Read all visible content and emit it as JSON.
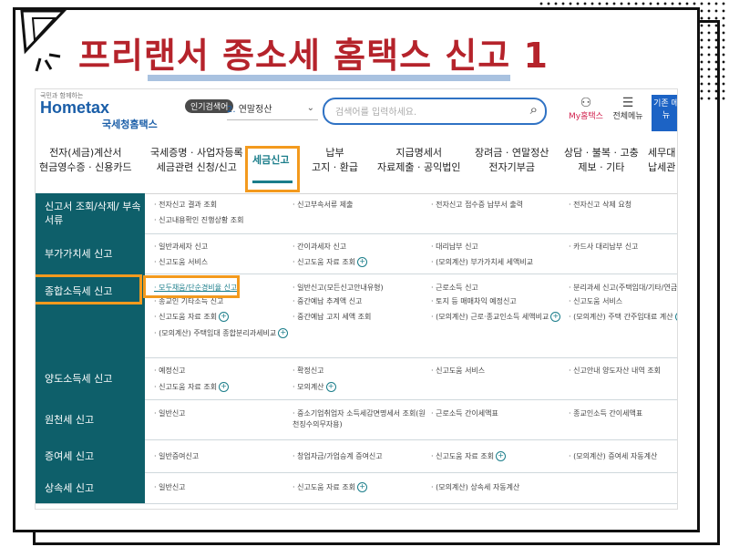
{
  "header": {
    "title": "프리랜서 종소세 홈택스 신고 1"
  },
  "topbar": {
    "logo_small": "국민과 함께하는",
    "logo_main": "Hometax",
    "logo_kr": "국세청홈택스",
    "popular_badge": "인기검색어",
    "popular_num": "2.",
    "popular_text": "연말정산",
    "search_placeholder": "검색어를 입력하세요.",
    "myhome_label": "My홈택스",
    "allmenu_label": "전체메뉴",
    "old_btn_label": "기존 메뉴"
  },
  "nav": [
    {
      "line1": "전자(세금)계산서",
      "line2": "현금영수증 · 신용카드"
    },
    {
      "line1": "국세증명 · 사업자등록",
      "line2": "세금관련 신청/신고"
    },
    {
      "line1": "세금신고",
      "line2": ""
    },
    {
      "line1": "납부",
      "line2": "고지 · 환급"
    },
    {
      "line1": "지급명세서",
      "line2": "자료제출 · 공익법인"
    },
    {
      "line1": "장려금 · 연말정산",
      "line2": "전자기부금"
    },
    {
      "line1": "상담 · 불복 · 고충",
      "line2": "제보 · 기타"
    },
    {
      "line1": "세무대",
      "line2": "납세관"
    }
  ],
  "rows": [
    {
      "cat": "신고서 조회/삭제/ 부속서류",
      "items": [
        "전자신고 결과 조회",
        "신고부속서류 제출",
        "전자신고 접수증 납부서 출력",
        "전자신고 삭제 요청",
        "신고내용확인 진행상황 조회"
      ]
    },
    {
      "cat": "부가가치세 신고",
      "items": [
        "일반과세자 신고",
        "간이과세자 신고",
        "대리납부 신고",
        "카드사 대리납부 신고",
        "신고도움 서비스",
        "신고도움 자료 조회",
        "(모의계산) 부가가치세 세액비교"
      ]
    },
    {
      "cat": "종합소득세 신고",
      "items": [
        "모두채움/단순경비율 신고",
        "일반신고(모든신고안내유형)",
        "근로소득 신고",
        "분리과세 신고(주택임대/기타/연금)",
        "종교인 기타소득 신고",
        "중간예납 추계액 신고",
        "토지 등 매매차익 예정신고",
        "신고도움 서비스",
        "신고도움 자료 조회",
        "중간예납 고지 세액 조회",
        "(모의계산) 근로·종교인소득 세액비교",
        "(모의계산) 주택 간주임대료 계산",
        "(모의계산) 주택임대 종합분리과세비교"
      ]
    },
    {
      "cat": "양도소득세 신고",
      "items": [
        "예정신고",
        "확정신고",
        "신고도움 서비스",
        "신고안내 양도자산 내역 조회",
        "신고도움 자료 조회",
        "모의계산"
      ]
    },
    {
      "cat": "원천세 신고",
      "items": [
        "일반신고",
        "중소기업취업자 소득세감면명세서 조회(원천징수의무자용)",
        "근로소득 간이세액표",
        "종교인소득 간이세액표"
      ]
    },
    {
      "cat": "증여세 신고",
      "items": [
        "일반증여신고",
        "창업자금/가업승계 증여신고",
        "신고도움 자료 조회",
        "(모의계산) 증여세 자동계산"
      ]
    },
    {
      "cat": "상속세 신고",
      "items": [
        "일반신고",
        "신고도움 자료 조회",
        "(모의계산) 상속세 자동계산"
      ]
    }
  ],
  "colors": {
    "title_red": "#b5232b",
    "teal": "#0e5f6a",
    "orange": "#f39a1e",
    "blue": "#1c63c5"
  }
}
